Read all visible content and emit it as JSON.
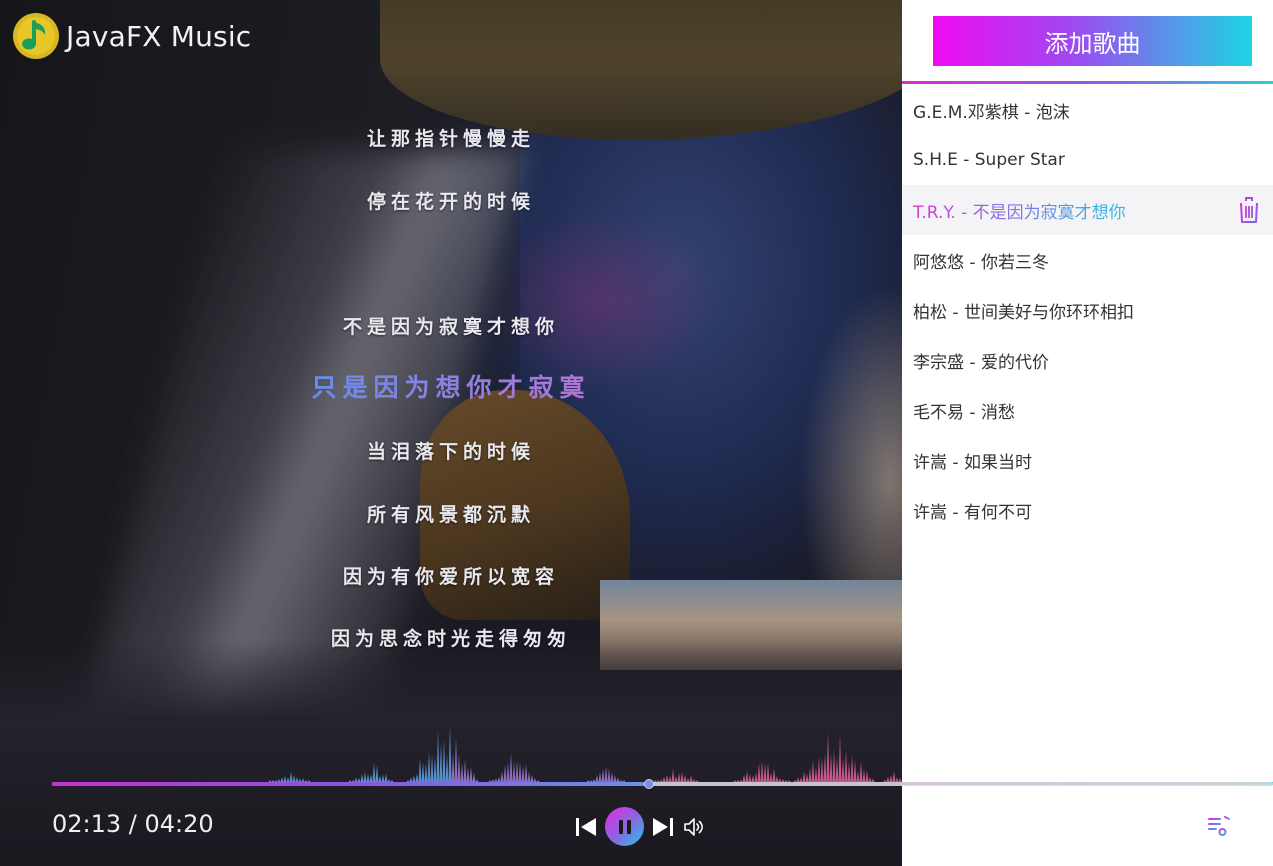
{
  "app": {
    "title": "JavaFX Music"
  },
  "lyrics": {
    "lines": [
      "让那指针慢慢走",
      "停在花开的时候",
      "",
      "不是因为寂寞才想你",
      "只是因为想你才寂寞",
      "当泪落下的时候",
      "所有风景都沉默",
      "因为有你爱所以宽容",
      "因为思念时光走得匆匆"
    ],
    "current_index": 4
  },
  "player": {
    "time_display": "02:13 / 04:20",
    "progress_fraction": 0.49,
    "controls": {
      "prev_icon": "skip-previous-icon",
      "play_pause_icon": "pause-icon",
      "next_icon": "skip-next-icon",
      "volume_icon": "volume-icon"
    }
  },
  "playlist": {
    "add_button_label": "添加歌曲",
    "songs": [
      {
        "title": "G.E.M.邓紫棋 - 泡沫",
        "active": false
      },
      {
        "title": "S.H.E - Super Star",
        "active": false
      },
      {
        "title": "T.R.Y. - 不是因为寂寞才想你",
        "active": true
      },
      {
        "title": "阿悠悠 - 你若三冬",
        "active": false
      },
      {
        "title": "柏松 - 世间美好与你环环相扣",
        "active": false
      },
      {
        "title": "李宗盛 - 爱的代价",
        "active": false
      },
      {
        "title": "毛不易 - 消愁",
        "active": false
      },
      {
        "title": "许嵩 - 如果当时",
        "active": false
      },
      {
        "title": "许嵩 - 有何不可",
        "active": false
      }
    ],
    "delete_icon": "trash-icon",
    "toggle_icon": "playlist-music-icon"
  },
  "colors": {
    "accent_pink": "#e12be0",
    "accent_purple": "#8f63e0",
    "accent_cyan": "#1fc7e6",
    "lyric_current_start": "#2fb6e8",
    "lyric_current_end": "#e6607e"
  }
}
